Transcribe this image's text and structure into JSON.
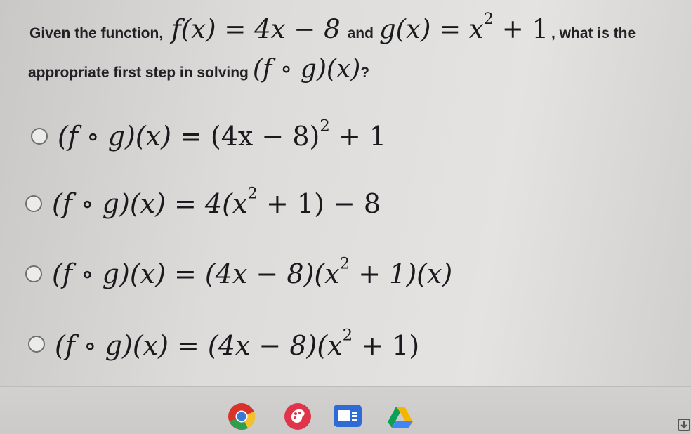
{
  "question": {
    "intro": "Given the function,",
    "f_def_lhs": "f(x)",
    "f_def_rhs": "4x − 8",
    "and": "and",
    "g_def_lhs": "g(x)",
    "g_def_rhs_base": "x",
    "g_def_rhs_exp": "2",
    "g_def_rhs_tail": "+ 1",
    "comma_tail": ", what is the",
    "line2_text": "appropriate first step in solving",
    "target": "(f ∘ g)(x)",
    "qmark": "?"
  },
  "options": [
    {
      "lhs": "(f ∘ g)(x) =",
      "rhs_a": "(4x − 8)",
      "exp": "2",
      "rhs_b": "+ 1"
    },
    {
      "lhs": "(f ∘ g)(x) =",
      "rhs_a": "4(x",
      "exp": "2",
      "rhs_b": "+ 1) − 8"
    },
    {
      "lhs": "(f ∘ g)(x) =",
      "rhs_a": "(4x − 8)(x",
      "exp": "2",
      "rhs_b": "+ 1)(x)"
    },
    {
      "lhs": "(f ∘ g)(x) =",
      "rhs_a": "(4x − 8)(x",
      "exp": "2",
      "rhs_b": "+ 1)"
    }
  ],
  "taskbar": {
    "apps": [
      {
        "name": "chrome-icon",
        "color": "#d9322b"
      },
      {
        "name": "palette-icon",
        "color": "#e0344a"
      },
      {
        "name": "slides-icon",
        "color": "#2f6bd6"
      },
      {
        "name": "drive-icon",
        "color": "#f4b400"
      }
    ]
  }
}
